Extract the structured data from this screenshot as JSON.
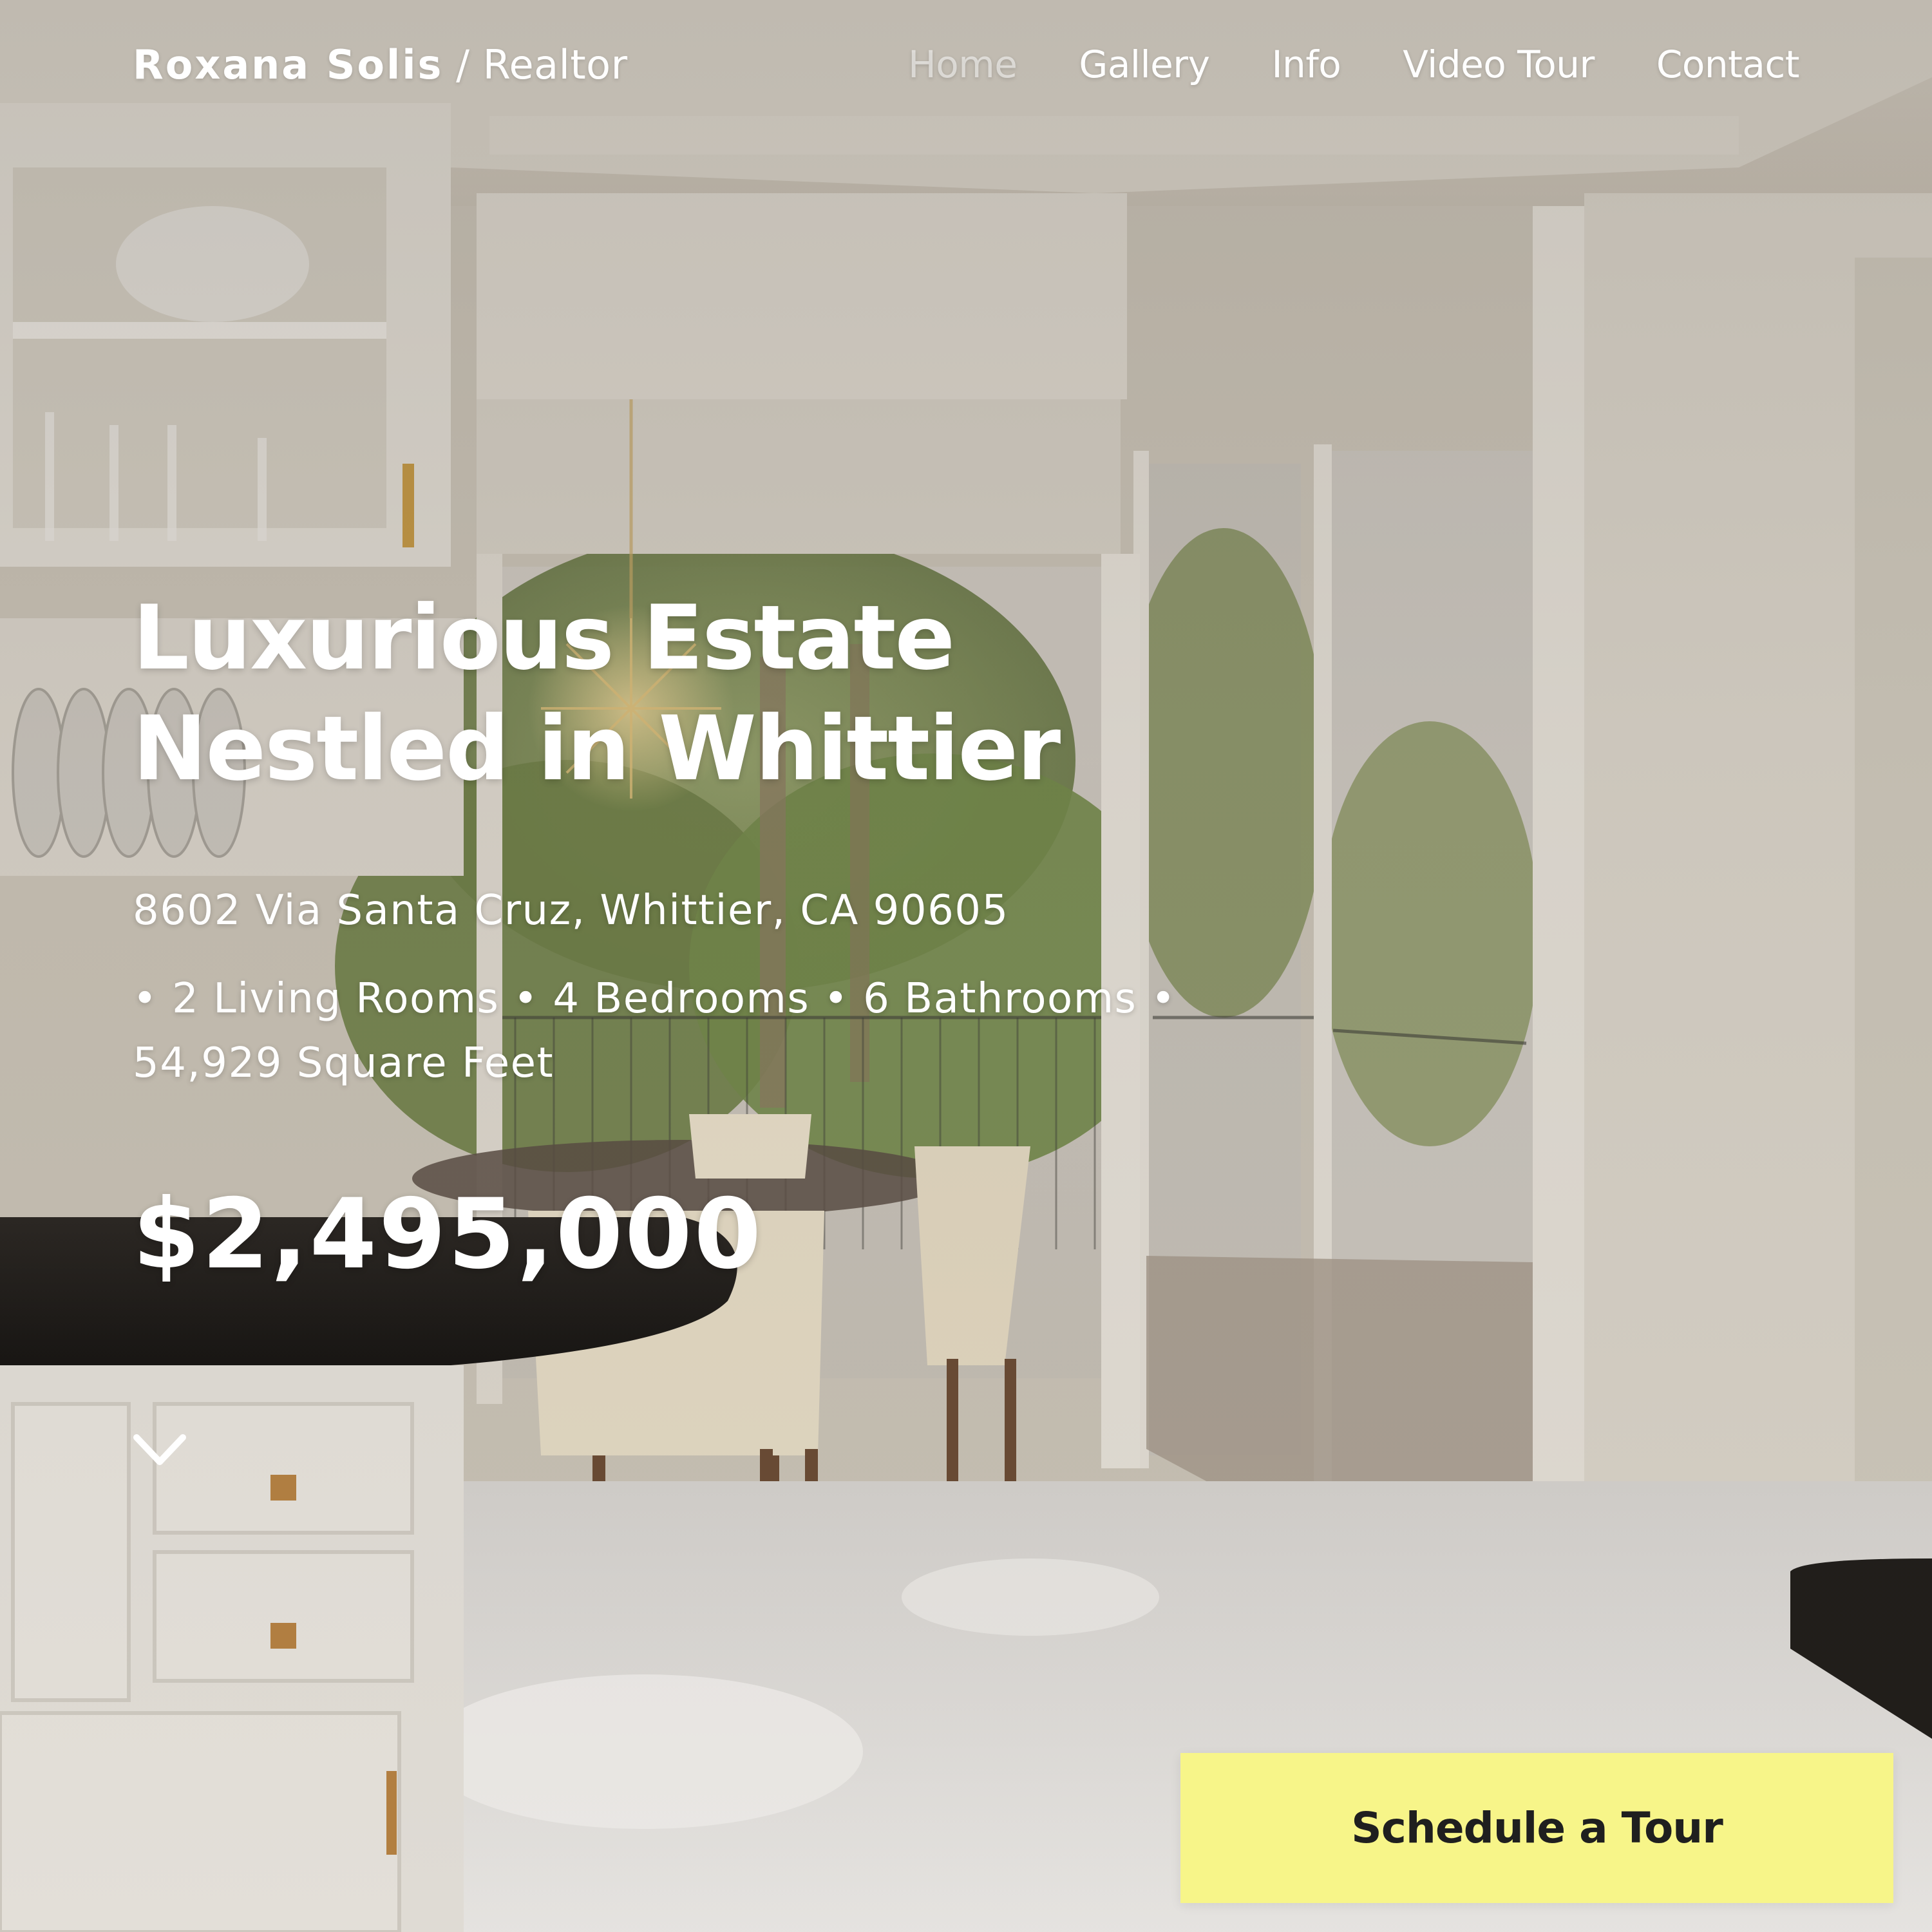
{
  "brand": {
    "name": "Roxana Solis",
    "role": "/ Realtor"
  },
  "nav": {
    "items": [
      {
        "label": "Home",
        "active": true
      },
      {
        "label": "Gallery",
        "active": false
      },
      {
        "label": "Info",
        "active": false
      },
      {
        "label": "Video Tour",
        "active": false
      },
      {
        "label": "Contact",
        "active": false
      }
    ]
  },
  "hero": {
    "title_line1": "Luxurious Estate",
    "title_line2": "Nestled in Whittier",
    "address": "8602 Via Santa Cruz, Whittier, CA 90605",
    "features": "• 2 Living Rooms • 4 Bedrooms • 6 Bathrooms • 54,929 Square Feet",
    "price": "$2,495,000",
    "scroll_icon": "chevron-down-icon"
  },
  "cta": {
    "label": "Schedule a Tour"
  },
  "colors": {
    "cta_background": "#f7f589",
    "cta_text": "#1f1f1f",
    "text": "#ffffff",
    "nav_active": "rgba(255,255,255,0.55)"
  }
}
